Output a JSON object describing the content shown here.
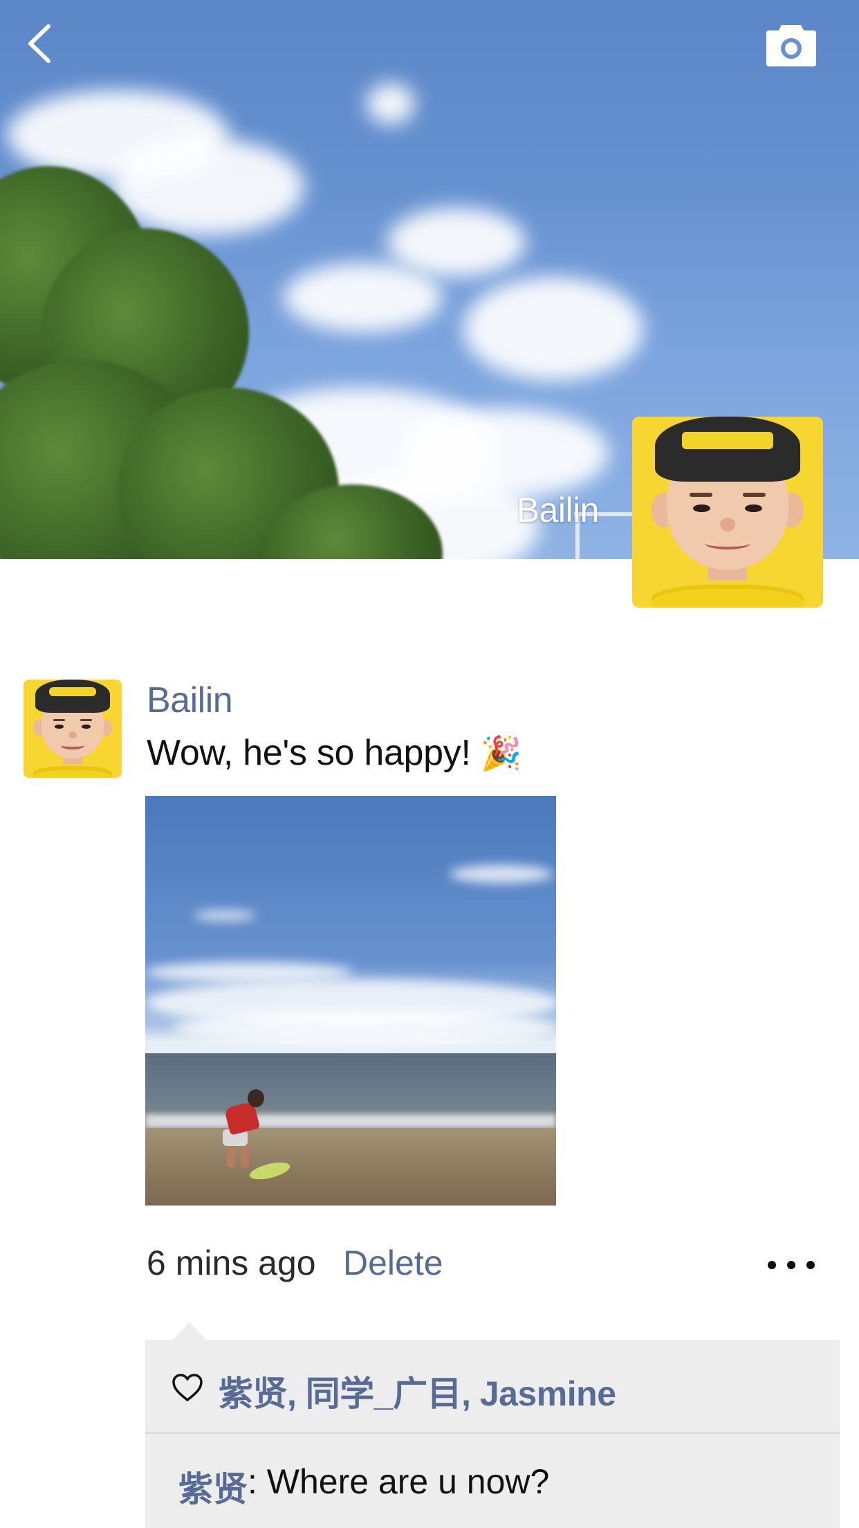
{
  "header": {
    "back_icon": "chevron-left-icon",
    "camera_icon": "camera-icon",
    "profile_name": "Bailin"
  },
  "post": {
    "author": "Bailin",
    "text": "Wow, he's so happy!",
    "emoji": "🎉",
    "time": "6 mins ago",
    "delete_label": "Delete",
    "more_icon": "ellipsis-icon"
  },
  "likes": {
    "icon": "heart-outline-icon",
    "names": "紫贤, 同学_广目, Jasmine"
  },
  "comments": [
    {
      "author": "紫贤",
      "text": ": Where are u now?"
    }
  ],
  "colors": {
    "link_blue": "#576b95",
    "panel_gray": "#ededed",
    "sky_blue": "#6792d0",
    "avatar_yellow": "#f7d631"
  }
}
